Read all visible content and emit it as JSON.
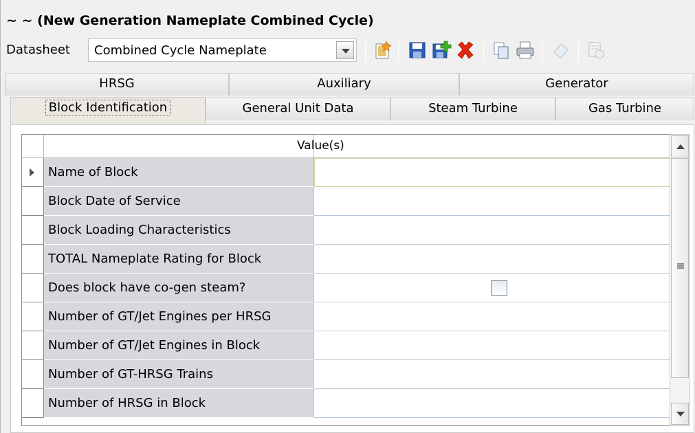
{
  "header": {
    "title": "~ ~ (New Generation Nameplate Combined Cycle)"
  },
  "datasheet": {
    "label": "Datasheet",
    "selected": "Combined Cycle Nameplate"
  },
  "toolbar": {
    "icons": [
      "new-icon",
      "save-icon",
      "save-as-new-icon",
      "delete-icon",
      "copy-icon",
      "print-icon",
      "clear-icon",
      "disabled-report-icon"
    ]
  },
  "tabs_row1": [
    {
      "label": "HRSG"
    },
    {
      "label": "Auxiliary"
    },
    {
      "label": "Generator"
    }
  ],
  "tabs_row2": [
    {
      "label": "Block Identification",
      "active": true
    },
    {
      "label": "General Unit Data"
    },
    {
      "label": "Steam Turbine"
    },
    {
      "label": "Gas Turbine"
    }
  ],
  "grid": {
    "value_header": "Value(s)",
    "rows": [
      {
        "label": "Name of Block",
        "value": ""
      },
      {
        "label": "Block Date of Service",
        "value": ""
      },
      {
        "label": "Block Loading Characteristics",
        "value": ""
      },
      {
        "label": "TOTAL Nameplate Rating for Block",
        "value": ""
      },
      {
        "label": "Does block have co-gen steam?",
        "value": "checkbox-unchecked"
      },
      {
        "label": "Number of GT/Jet Engines per HRSG",
        "value": ""
      },
      {
        "label": "Number of GT/Jet Engines in Block",
        "value": ""
      },
      {
        "label": "Number of GT-HRSG Trains",
        "value": ""
      },
      {
        "label": "Number of HRSG in Block",
        "value": ""
      }
    ]
  },
  "colors": {
    "label_cell_bg": "#d6d8dc",
    "delete_red": "#e02a10",
    "save_blue": "#2c5fb8"
  }
}
